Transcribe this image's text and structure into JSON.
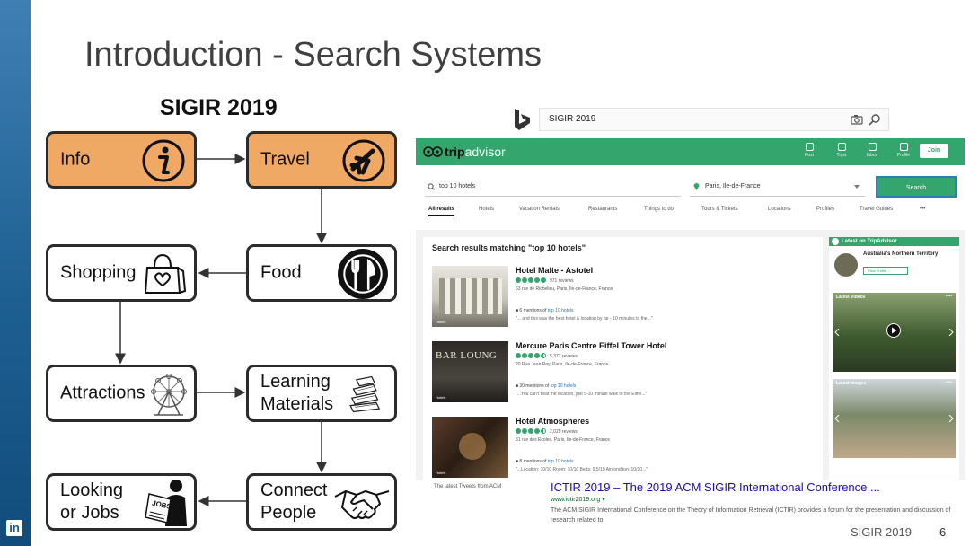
{
  "slide": {
    "title": "Introduction - Search Systems",
    "conference_footer": "SIGIR 2019",
    "page_number": "6",
    "stripe_logo": "in"
  },
  "diagram": {
    "heading": "SIGIR 2019",
    "nodes": [
      {
        "id": "info",
        "label": "Info",
        "icon": "info-icon",
        "highlight": true
      },
      {
        "id": "travel",
        "label": "Travel",
        "icon": "airplane-icon",
        "highlight": true
      },
      {
        "id": "food",
        "label": "Food",
        "icon": "fork-knife-icon",
        "highlight": false
      },
      {
        "id": "shopping",
        "label": "Shopping",
        "icon": "shopping-bag-icon",
        "highlight": false
      },
      {
        "id": "attractions",
        "label": "Attractions",
        "icon": "ferris-wheel-icon",
        "highlight": false
      },
      {
        "id": "learning",
        "label": "Learning\nMaterials",
        "icon": "books-icon",
        "highlight": false
      },
      {
        "id": "connect",
        "label": "Connect\nPeople",
        "icon": "handshake-icon",
        "highlight": false
      },
      {
        "id": "jobs",
        "label": "Looking\nor Jobs",
        "icon": "jobs-newspaper-icon",
        "highlight": false
      }
    ],
    "colors": {
      "highlight": "#f0a865",
      "border": "#2b2b2b"
    }
  },
  "bing": {
    "query": "SIGIR 2019",
    "result": {
      "tweets_label": "The latest Tweets from ACM",
      "title": "ICTIR 2019 – The 2019 ACM SIGIR International Conference ...",
      "url": "www.ictir2019.org ▾",
      "description": "The ACM SIGIR International Conference on the Theory of Information Retrieval (ICTIR) provides a forum for the presentation and discussion of research related to"
    }
  },
  "tripadvisor": {
    "brand_light": "trip",
    "brand_dark": "advisor",
    "nav": [
      "Post",
      "Trips",
      "Inbox",
      "Profile"
    ],
    "join_label": "Join",
    "search_query": "top 10 hotels",
    "location": "Paris, Ile-de-France",
    "search_button": "Search",
    "tabs": [
      "All results",
      "Hotels",
      "Vacation Rentals",
      "Restaurants",
      "Things to do",
      "Tours & Tickets",
      "Locations",
      "Profiles",
      "Travel Guides",
      "•••"
    ],
    "results_title": "Search results matching \"top 10 hotels\"",
    "hotels": [
      {
        "name": "Hotel Malte - Astotel",
        "reviews": "971 reviews",
        "address": "63 rue de Richelieu, Paris, Ile-de-France, France",
        "mention_prefix": "6 mentions of",
        "mention_link": "top 10 hotels",
        "snippet": "\"... and this was the best hotel & location by far - 10 minutes to the...\"",
        "photo_label": "Hotels"
      },
      {
        "name": "Mercure Paris Centre Eiffel Tower Hotel",
        "reviews": "5,377 reviews",
        "address": "20 Rue Jean Rey, Paris, Ile-de-France, France",
        "mention_prefix": "30 mentions of",
        "mention_link": "top 10 hotels",
        "snippet": "\"...You can't beat the location, just 5-10 minute walk to the Eiffel...\"",
        "photo_label": "Hotels",
        "photo_sign": "BAR LOUNG"
      },
      {
        "name": "Hotel Atmospheres",
        "reviews": "2,029 reviews",
        "address": "31 rue des Ecoles, Paris, Ile-de-France, France",
        "mention_prefix": "8 mentions of",
        "mention_link": "top 10 hotels",
        "snippet": "\"...Location: 10/10 Room: 10/10 Beds: 9,5/10 Airconditon: 10/10...\"",
        "photo_label": "Hotels"
      }
    ],
    "sidebar": {
      "heading": "Latest on TripAdvisor",
      "profile_name": "Australia's Northern Territory",
      "profile_button": "View Profile",
      "videos_label": "Latest Videos",
      "images_label": "Latest Images",
      "more_dots": "••••"
    },
    "colors": {
      "brand": "#34a56c",
      "link": "#2b73b5"
    }
  }
}
